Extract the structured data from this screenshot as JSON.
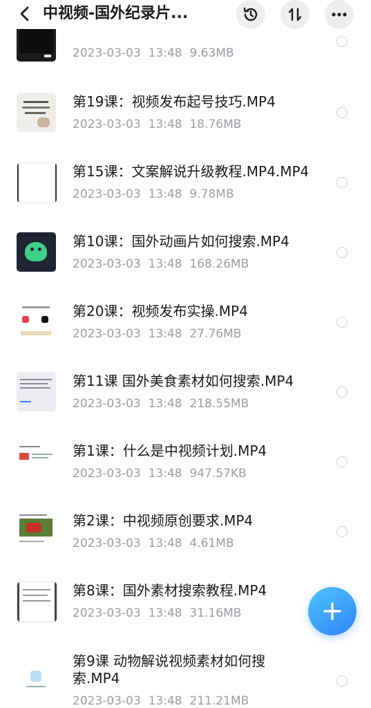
{
  "header": {
    "title": "中视频-国外纪录片..."
  },
  "icons": {
    "back": "chevron-left-icon",
    "history": "history-clock-icon",
    "sort": "sort-arrows-icon",
    "more": "more-dots-icon",
    "add": "plus-icon",
    "select": "radio-circle-icon"
  },
  "colors": {
    "fab_start": "#4fc3ff",
    "fab_end": "#2f86f6",
    "meta_text": "#9c9ca3"
  },
  "files": [
    {
      "name": "",
      "date": "2023-03-03",
      "time": "13:48",
      "size": "9.63MB"
    },
    {
      "name": "第19课：视频发布起号技巧.MP4",
      "date": "2023-03-03",
      "time": "13:48",
      "size": "18.76MB"
    },
    {
      "name": "第15课：文案解说升级教程.MP4.MP4",
      "date": "2023-03-03",
      "time": "13:48",
      "size": "9.78MB"
    },
    {
      "name": "第10课：国外动画片如何搜索.MP4",
      "date": "2023-03-03",
      "time": "13:48",
      "size": "168.26MB"
    },
    {
      "name": "第20课：视频发布实操.MP4",
      "date": "2023-03-03",
      "time": "13:48",
      "size": "27.76MB"
    },
    {
      "name": "第11课 国外美食素材如何搜索.MP4",
      "date": "2023-03-03",
      "time": "13:48",
      "size": "218.55MB"
    },
    {
      "name": "第1课：什么是中视频计划.MP4",
      "date": "2023-03-03",
      "time": "13:48",
      "size": "947.57KB"
    },
    {
      "name": "第2课：中视频原创要求.MP4",
      "date": "2023-03-03",
      "time": "13:48",
      "size": "4.61MB"
    },
    {
      "name": "第8课：国外素材搜索教程.MP4",
      "date": "2023-03-03",
      "time": "13:48",
      "size": "31.16MB"
    },
    {
      "name": "第9课 动物解说视频素材如何搜索.MP4",
      "date": "2023-03-03",
      "time": "13:48",
      "size": "211.21MB"
    }
  ]
}
